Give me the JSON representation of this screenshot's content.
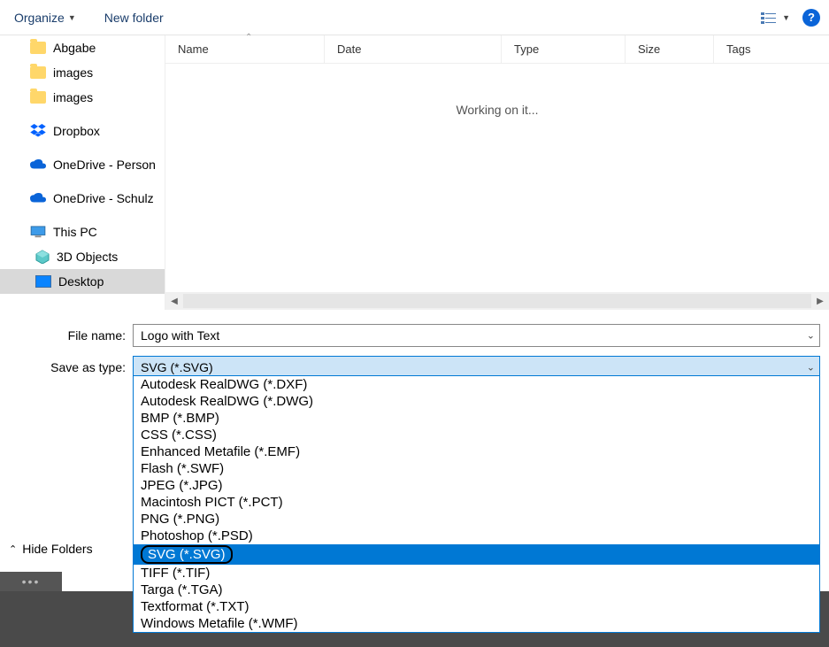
{
  "toolbar": {
    "organize": "Organize",
    "new_folder": "New folder"
  },
  "sidebar": {
    "items": [
      {
        "label": "Abgabe"
      },
      {
        "label": "images"
      },
      {
        "label": "images"
      },
      {
        "label": "Dropbox"
      },
      {
        "label": "OneDrive - Person"
      },
      {
        "label": "OneDrive - Schulz"
      },
      {
        "label": "This PC"
      },
      {
        "label": "3D Objects"
      },
      {
        "label": "Desktop"
      }
    ]
  },
  "columns": {
    "name": "Name",
    "date": "Date",
    "type": "Type",
    "size": "Size",
    "tags": "Tags"
  },
  "status": {
    "working": "Working on it..."
  },
  "form": {
    "filename_label": "File name:",
    "filename_value": "Logo with Text",
    "saveas_label": "Save as type:",
    "saveas_value": "SVG (*.SVG)"
  },
  "type_options": [
    "Autodesk RealDWG (*.DXF)",
    "Autodesk RealDWG (*.DWG)",
    "BMP (*.BMP)",
    "CSS (*.CSS)",
    "Enhanced Metafile (*.EMF)",
    "Flash (*.SWF)",
    "JPEG (*.JPG)",
    "Macintosh PICT (*.PCT)",
    "PNG (*.PNG)",
    "Photoshop (*.PSD)",
    "SVG (*.SVG)",
    "TIFF (*.TIF)",
    "Targa (*.TGA)",
    "Textformat (*.TXT)",
    "Windows Metafile (*.WMF)"
  ],
  "selected_type_index": 10,
  "footer": {
    "hide_folders": "Hide Folders"
  }
}
